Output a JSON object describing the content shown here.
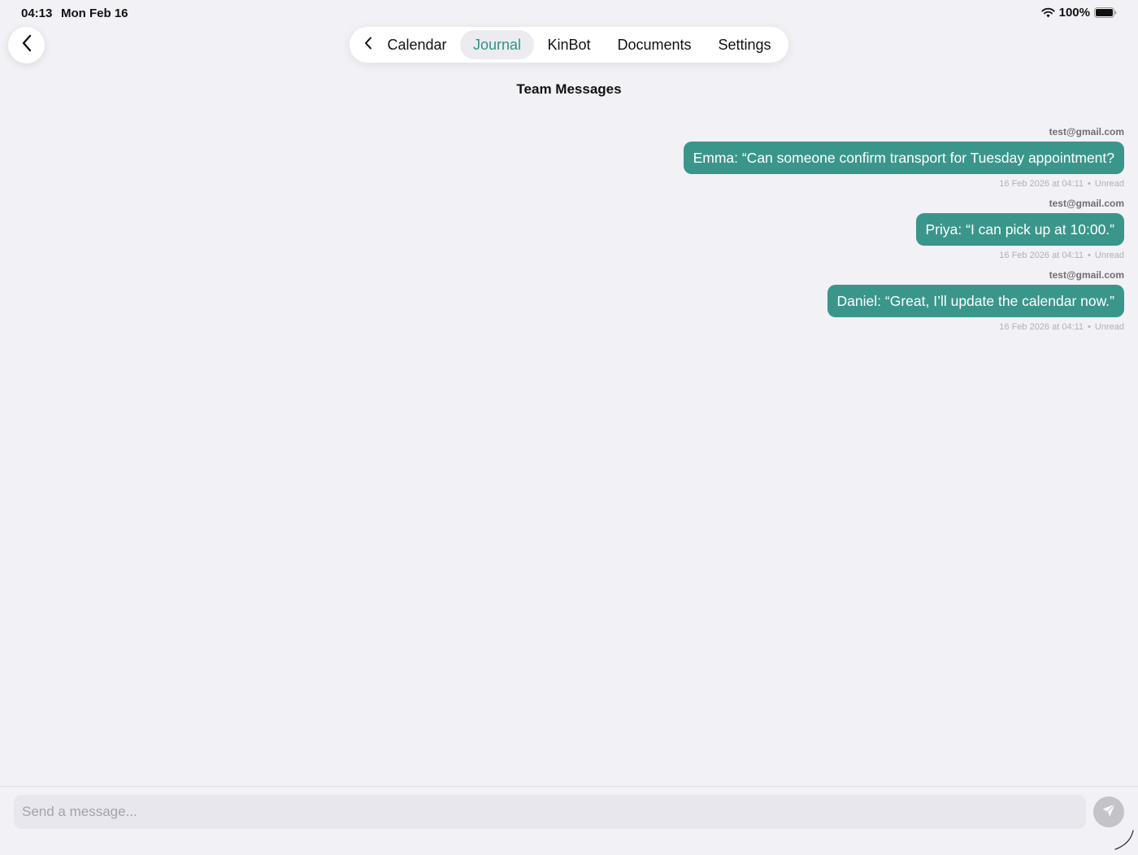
{
  "status_bar": {
    "time": "04:13",
    "date": "Mon Feb 16",
    "battery": "100%"
  },
  "nav": {
    "tabs": [
      {
        "label": "Calendar",
        "active": false
      },
      {
        "label": "Journal",
        "active": true
      },
      {
        "label": "KinBot",
        "active": false
      },
      {
        "label": "Documents",
        "active": false
      },
      {
        "label": "Settings",
        "active": false
      }
    ]
  },
  "page": {
    "title": "Team Messages"
  },
  "messages": [
    {
      "sender": "test@gmail.com",
      "text": "Emma: “Can someone confirm transport for Tuesday appointment?",
      "timestamp": "16 Feb 2026 at 04:11",
      "status": "Unread"
    },
    {
      "sender": "test@gmail.com",
      "text": "Priya: “I can pick up at 10:00.”",
      "timestamp": "16 Feb 2026 at 04:11",
      "status": "Unread"
    },
    {
      "sender": "test@gmail.com",
      "text": "Daniel: “Great, I’ll update the calendar now.”",
      "timestamp": "16 Feb 2026 at 04:11",
      "status": "Unread"
    }
  ],
  "composer": {
    "placeholder": "Send a message...",
    "value": ""
  },
  "colors": {
    "accent": "#3a968b",
    "background": "#f2f1f6",
    "send_button_disabled": "#c4c3c8"
  },
  "icons": {
    "back": "chevron-left-icon",
    "send": "paper-plane-icon",
    "wifi": "wifi-icon",
    "battery": "battery-full-icon"
  }
}
